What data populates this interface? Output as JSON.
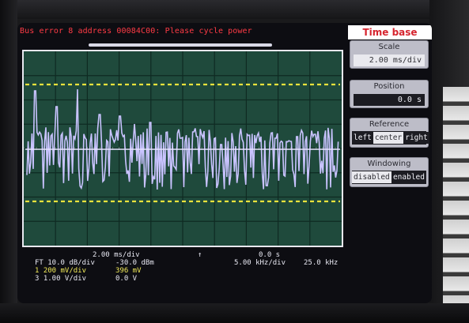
{
  "status_message": "Bus error 8 address 00084C00: Please cycle power",
  "side_panel": {
    "title": "Time base",
    "scale": {
      "label": "Scale",
      "value": "2.00 ms/div"
    },
    "position": {
      "label": "Position",
      "value": "0.0 s"
    },
    "reference": {
      "label": "Reference",
      "options": [
        "left",
        "center",
        "right"
      ],
      "selected": "center"
    },
    "windowing": {
      "label": "Windowing",
      "options": [
        "disabled",
        "enabled"
      ],
      "selected": "disabled"
    }
  },
  "readouts": {
    "timebase_div": "2.00 ms/div",
    "trigger_marker": "↑",
    "timebase_pos": "0.0 s",
    "ft_line": {
      "label": "FT 10.0 dB/div",
      "value": "-30.0 dBm",
      "freq_div": "5.00 kHz/div",
      "freq_center": "25.0 kHz"
    },
    "ch1_line": {
      "label": "1  200 mV/div",
      "value": "396 mV"
    },
    "ch3_line": {
      "label": "3  1.00 V/div",
      "value": "0.0 V"
    }
  },
  "colors": {
    "status_text": "#ff3b45",
    "graticule_bg": "#1f4a3c",
    "fft_trace": "#c9c3ff",
    "yellow_dashes": "#e9e23c",
    "panel_title_text": "#d6242e"
  }
}
